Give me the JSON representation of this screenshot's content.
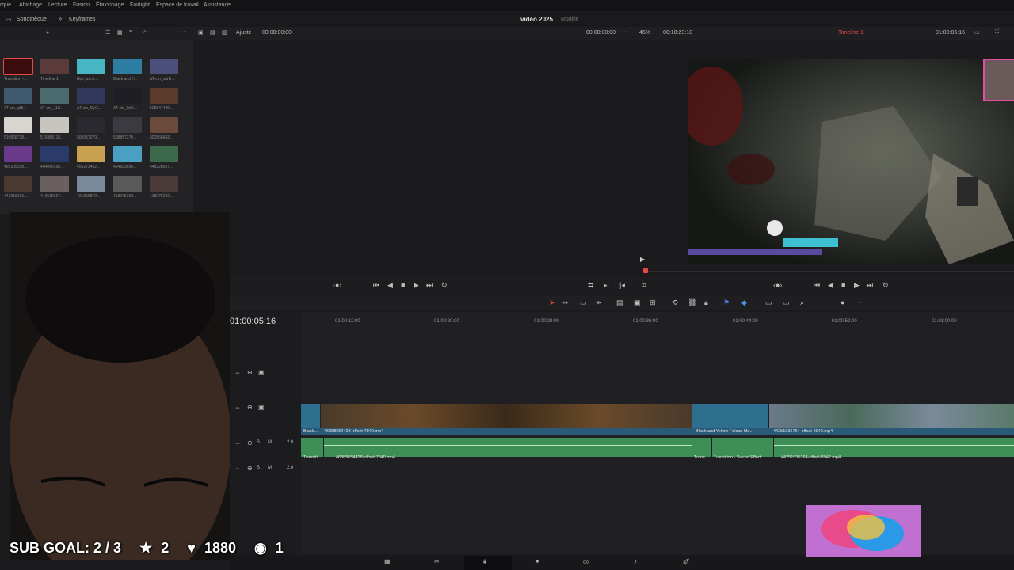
{
  "menu": [
    "rque",
    "Affichage",
    "Lecture",
    "Fusion",
    "Étalonnage",
    "Fairlight",
    "Espace de travail",
    "Assistance"
  ],
  "topbar": {
    "library_btn": "Sonothèque",
    "keyframes_btn": "Keyframes",
    "project_title": "vidéo 2025",
    "project_status": "Modifié"
  },
  "toolbar2": {
    "fit_label": "Ajusté",
    "src_timecode": "00:00:00:00",
    "prog_timecode_left": "00:00:00:00",
    "zoom": "46%",
    "duration": "00:10:23:10",
    "timeline_name": "Timeline 1",
    "prog_timecode_right": "01:00:05:16"
  },
  "media_pool": [
    {
      "label": "Transition -...",
      "color": "#3a0c0c"
    },
    {
      "label": "Timeline 1",
      "color": "#5b3a3a"
    },
    {
      "label": "Noir jaune...",
      "color": "#48b5c4"
    },
    {
      "label": "Black and Y...",
      "color": "#2e7da3"
    },
    {
      "label": "AT-cm_sarki...",
      "color": "#4b4f7a"
    },
    {
      "label": "AT-cm_qHi...",
      "color": "#3f5a6e"
    },
    {
      "label": "AT-cm_118...",
      "color": "#4b6b6e"
    },
    {
      "label": "AT-cm_DyC...",
      "color": "#32385a"
    },
    {
      "label": "AT-cm_0oK...",
      "color": "#1e1e24"
    },
    {
      "label": "525547499...",
      "color": "#5a3a2a"
    },
    {
      "label": "516868718...",
      "color": "#d8d4d0"
    },
    {
      "label": "516868718...",
      "color": "#c8c4c0"
    },
    {
      "label": "508957270...",
      "color": "#2a2a30"
    },
    {
      "label": "508857270...",
      "color": "#3a3a40"
    },
    {
      "label": "502868643...",
      "color": "#6a4a3a"
    },
    {
      "label": "465305158...",
      "color": "#6a3a8a"
    },
    {
      "label": "464040768...",
      "color": "#2a3a6a"
    },
    {
      "label": "456273462...",
      "color": "#c8a050"
    },
    {
      "label": "454603696...",
      "color": "#4aa0c0"
    },
    {
      "label": "448228957...",
      "color": "#3a6a4a"
    },
    {
      "label": "442919163...",
      "color": "#4a3a30"
    },
    {
      "label": "442510367...",
      "color": "#6a6060"
    },
    {
      "label": "421056872...",
      "color": "#7a8a9a"
    },
    {
      "label": "418075260...",
      "color": "#5a5a5a"
    },
    {
      "label": "418075260...",
      "color": "#4a3a3a"
    }
  ],
  "timeline": {
    "timecode": "01:00:05:16",
    "ruler": [
      "01:00:12:00",
      "01:00:20:00",
      "01:00:28:00",
      "01:00:36:00",
      "01:00:44:00",
      "01:00:52:00",
      "01:01:00:00"
    ],
    "audio_level_1": "2.0",
    "audio_level_2": "2.0",
    "track_s": "S",
    "track_m": "M",
    "video_clips": [
      {
        "label": "Black...",
        "color": "#1e6a8a"
      },
      {
        "label": "46888654428-offset-7840.mp4",
        "color": "#4a3a2a"
      },
      {
        "label": "Black and Yellow Falcon Mo...",
        "color": "#1e6a8a"
      },
      {
        "label": "44251036764-offset-8942.mp4",
        "color": "#5a7a8a"
      }
    ],
    "audio_clips": [
      {
        "label": "Transiti..."
      },
      {
        "label": "46888654428-offset-7840.mp4"
      },
      {
        "label": "Trans..."
      },
      {
        "label": "Transition - Sound Effect ..."
      },
      {
        "label": "44251036764-offset-8942.mp4"
      }
    ]
  },
  "overlay": {
    "sub_goal": "SUB GOAL: 2 / 3",
    "stars": "2",
    "hearts": "1880",
    "viewers": "1"
  },
  "bottom_tabs": [
    "Média",
    "Cut",
    "Montage",
    "Fusion",
    "Étalonnage",
    "Fairlight",
    "Exportation"
  ],
  "colors": {
    "accent_red": "#e84848",
    "video_clip": "#2e6f8f",
    "audio_clip": "#3e8f55"
  }
}
